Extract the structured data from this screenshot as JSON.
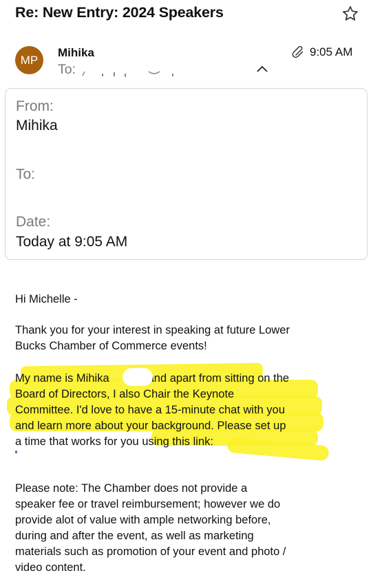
{
  "email": {
    "subject": "Re: New Entry: 2024 Speakers",
    "sender": {
      "initials": "MP",
      "name": "Mihika",
      "avatar_color": "#a8620f"
    },
    "to_prefix": "To:",
    "time": "9:05 AM",
    "icons": {
      "favorite": "star-icon",
      "attachment": "paperclip-icon",
      "collapse": "chevron-up-icon"
    }
  },
  "details": {
    "from_label": "From:",
    "from_value": "Mihika",
    "to_label": "To:",
    "date_label": "Date:",
    "date_value": "Today at 9:05 AM"
  },
  "body": {
    "greeting": "Hi Michelle -",
    "p1": [
      "Thank you for your interest in speaking at future Lower",
      "Bucks Chamber of Commerce events!"
    ],
    "p2_line1_start": "My name is Mihika",
    "p2_line1_end": "and apart from sitting on the",
    "p2_lines": [
      "Board of Directors, I also Chair the Keynote",
      "Committee. I'd love to have a 15-minute chat with you",
      "and learn more about your background. Please set up",
      "a time that works for you using this link:"
    ],
    "p3": [
      "Please note: The Chamber does not provide a",
      "speaker fee or travel reimbursement; however we do",
      "provide alot of value with ample networking before,",
      "during and after the event, as well as marketing",
      "materials such as promotion of your event and photo /",
      "video content."
    ],
    "highlight_color": "#fbf22b"
  }
}
